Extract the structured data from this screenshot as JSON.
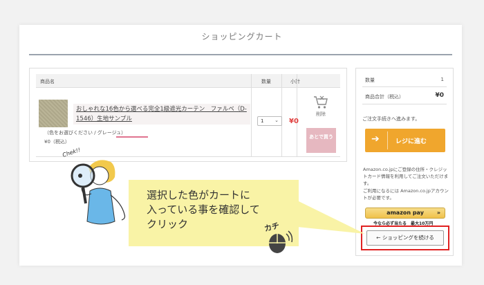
{
  "page": {
    "title": "ショッピングカート"
  },
  "cart": {
    "headers": {
      "name": "商品名",
      "qty": "数量",
      "subtotal": "小計"
    },
    "item": {
      "name": "おしゃれな16色から選べる完全1級遮光カーテン　ファルベ（D-1546）生地サンプル",
      "color": "（色をお選びください / グレージュ）",
      "price": "¥0（税込）",
      "quantity": "1",
      "subtotal": "¥0",
      "delete_label": "削除",
      "later_label": "あとで買う"
    }
  },
  "summary": {
    "qty_label": "数量",
    "qty_value": "1",
    "total_label": "商品合計（税込）",
    "total_value": "¥0",
    "note": "ご注文手続きへ進みます。",
    "register_button": "レジに進む",
    "register_arrow": "➔",
    "amazon_text1": "Amazon.co.jpにご登録の住所・クレジットカード情報を利用してご注文いただけます。",
    "amazon_text2": "ご利用になるには Amazon.co.jpアカウントが必要です。",
    "amazon_button": "amazon pay",
    "amazon_promo": "今なら必ず当たる　最大10万円",
    "continue_button": "← ショッピングを続ける"
  },
  "callout": {
    "line1": "選択した色がカートに",
    "line2": "入っている事を確認して",
    "line3": "クリック",
    "sound": "カチ",
    "check": "Chek!!"
  },
  "colors": {
    "register": "#f0a62d",
    "price": "#e0403f",
    "later": "#e6b8c0",
    "callout": "#f9f3a6",
    "highlight": "#e02020"
  }
}
